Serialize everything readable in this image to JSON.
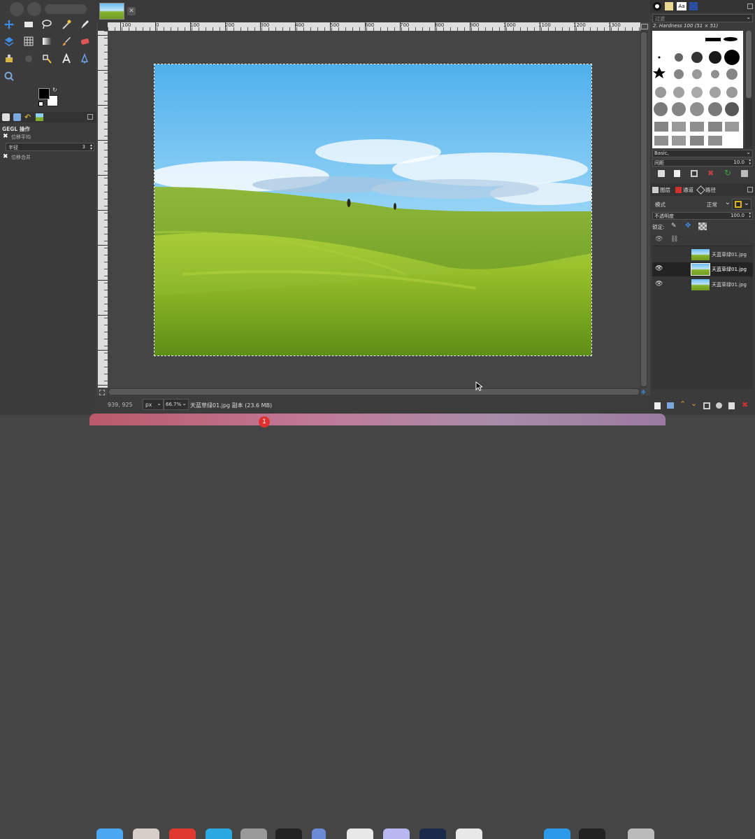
{
  "tab": {
    "close_glyph": "✕"
  },
  "tool_options": {
    "title": "GEGL 操作",
    "option1": "位移平均",
    "radius_label": "半径",
    "radius_value": "3",
    "option2": "位移合并"
  },
  "brushes": {
    "filter_placeholder": "过滤",
    "brush_name": "2. Hardness 100 (51 × 51)",
    "preset": "Basic,",
    "spacing_label": "间距",
    "spacing_value": "10.0"
  },
  "layers_panel": {
    "tabs": [
      "图层",
      "通道",
      "路径"
    ],
    "mode_label": "模式",
    "mode_value": "正常",
    "opacity_label": "不透明度",
    "opacity_value": "100.0",
    "lock_label": "锁定:",
    "layers": [
      {
        "name": "天蓝草绿01.jpg",
        "visible": false,
        "selected": false
      },
      {
        "name": "天蓝草绿01.jpg",
        "visible": true,
        "selected": true
      },
      {
        "name": "天蓝草绿01.jpg",
        "visible": true,
        "selected": false
      }
    ]
  },
  "ruler": {
    "labels": [
      "100",
      "0",
      "100",
      "200",
      "300",
      "400",
      "500",
      "600",
      "700",
      "800",
      "900",
      "1000",
      "1100",
      "1200",
      "1300",
      "1400",
      "1500",
      "1600",
      "1700",
      "1800",
      "1900"
    ]
  },
  "status": {
    "coords": "939, 925",
    "unit": "px",
    "zoom": "66.7%",
    "info": "天蓝草绿01.jpg 副本 (23.6 MB)"
  },
  "dock": {
    "badge": "1"
  },
  "colors": {
    "accent": "#2a7bd4",
    "sky": "#5fb8ef",
    "grass": "#7fae2a",
    "bg": "#454545"
  }
}
